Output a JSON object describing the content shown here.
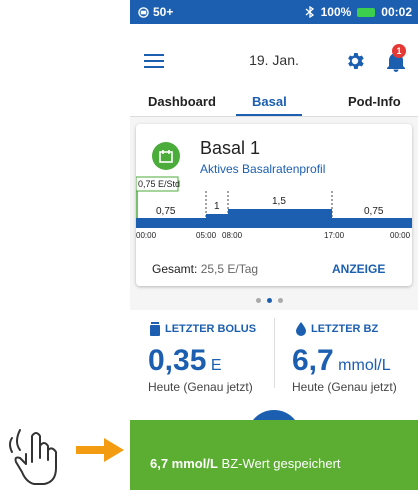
{
  "status": {
    "left": "50+",
    "battery": "100%",
    "time": "00:02"
  },
  "appbar": {
    "date": "19. Jan.",
    "notification_count": "1"
  },
  "tabs": [
    "Dashboard",
    "Basal",
    "Pod-Info"
  ],
  "basal": {
    "title": "Basal 1",
    "subtitle": "Aktives Basalratenprofil",
    "current_rate": "0,75 E/Std",
    "segment_labels": [
      "0,75",
      "1",
      "1,5",
      "0,75"
    ],
    "time_labels": [
      "00:00",
      "05:00",
      "08:00",
      "17:00",
      "00:00"
    ],
    "total_label": "Gesamt:",
    "total_value": "25,5 E/Tag",
    "view_button": "ANZEIGE"
  },
  "bolus": {
    "header": "LETZTER BOLUS",
    "value": "0,35",
    "unit": "E",
    "when": "Heute (Genau jetzt)"
  },
  "bg": {
    "header": "LETZTER BZ",
    "value": "6,7",
    "unit": "mmol/L",
    "when": "Heute (Genau jetzt)"
  },
  "toast": {
    "value": "6,7 mmol/L",
    "message": "BZ-Wert gespeichert"
  },
  "colors": {
    "primary": "#1c5fb0",
    "success": "#5cae32",
    "badge": "#e53935"
  }
}
